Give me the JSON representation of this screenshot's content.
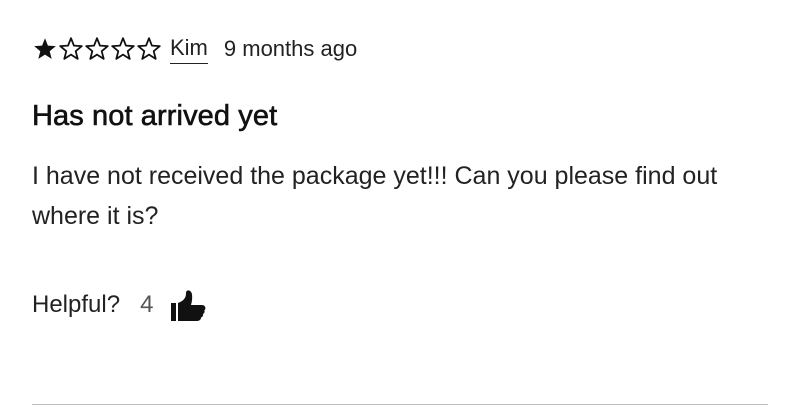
{
  "review": {
    "rating": 1,
    "max_rating": 5,
    "author": "Kim",
    "date": "9 months ago",
    "title": "Has not arrived yet",
    "body": "I have not received the package yet!!! Can you please find out where it is?",
    "helpful_label": "Helpful?",
    "helpful_count": "4"
  },
  "icons": {
    "star_filled": "star-filled-icon",
    "star_outline": "star-outline-icon",
    "thumbs_up": "thumbs-up-icon"
  },
  "colors": {
    "text": "#222222",
    "star": "#111111",
    "divider": "#bdbdbd"
  }
}
